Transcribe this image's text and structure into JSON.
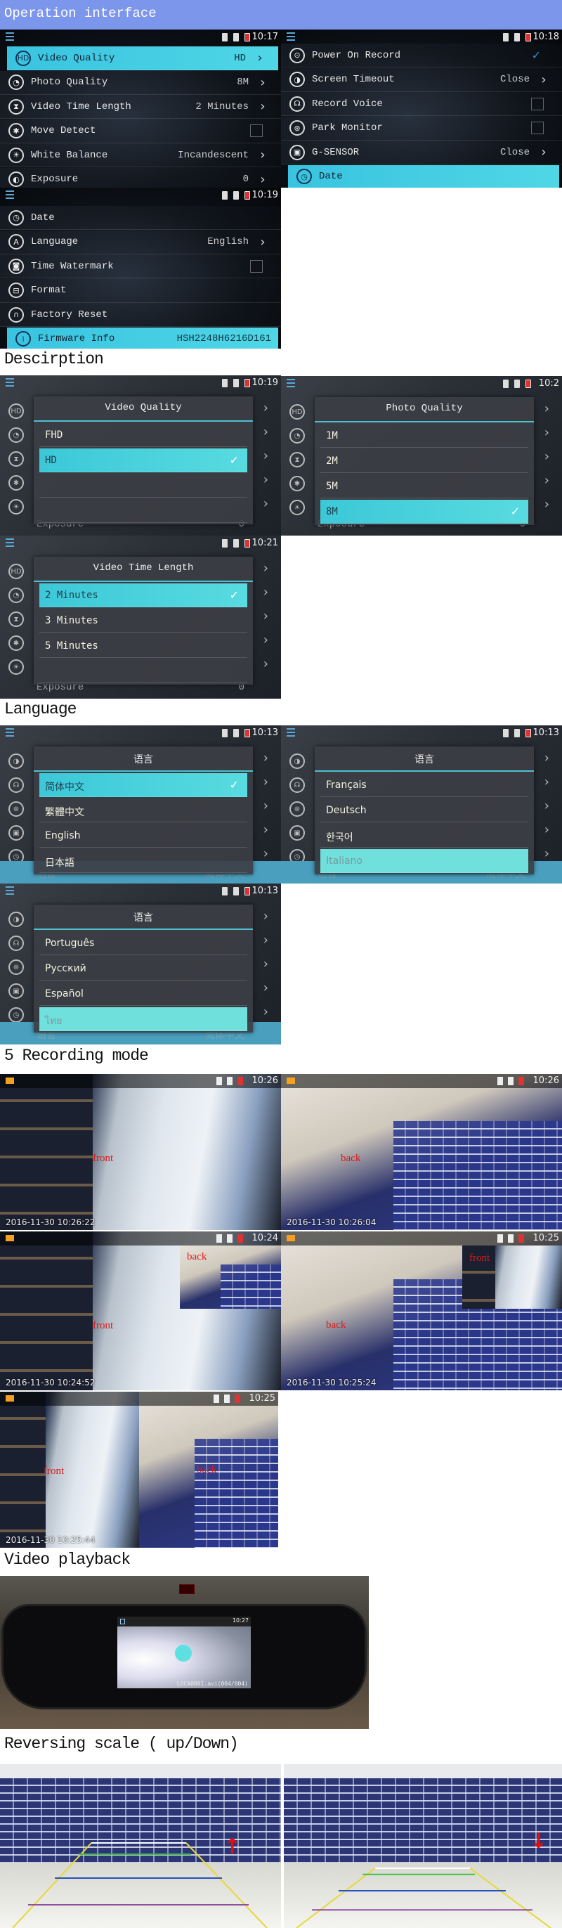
{
  "sections": {
    "operation": "Operation interface",
    "description": "Descirption",
    "language": "Language",
    "recording": "5 Recording mode",
    "playback": "Video playback",
    "reversing": "Reversing scale ( up/Down)"
  },
  "colors": {
    "header": "#7b96ea",
    "highlight": "#3fc8dc",
    "label_red": "#e01818"
  },
  "menus": [
    {
      "time": "10:17",
      "rows": [
        {
          "icon": "hd-icon",
          "label": "Video Quality",
          "value": "HD",
          "control": "chevron",
          "selected": true
        },
        {
          "icon": "photo-icon",
          "label": "Photo Quality",
          "value": "8M",
          "control": "chevron"
        },
        {
          "icon": "hourglass-icon",
          "label": "Video Time Length",
          "value": "2 Minutes",
          "control": "chevron"
        },
        {
          "icon": "walking-icon",
          "label": "Move Detect",
          "value": "",
          "control": "checkbox",
          "checked": false
        },
        {
          "icon": "sun-icon",
          "label": "White Balance",
          "value": "Incandescent",
          "control": "chevron"
        },
        {
          "icon": "exposure-icon",
          "label": "Exposure",
          "value": "0",
          "control": "chevron"
        }
      ]
    },
    {
      "time": "10:18",
      "rows": [
        {
          "icon": "power-icon",
          "label": "Power On Record",
          "value": "",
          "control": "check",
          "checked": true
        },
        {
          "icon": "toggle-icon",
          "label": "Screen Timeout",
          "value": "Close",
          "control": "chevron"
        },
        {
          "icon": "microphone-icon",
          "label": "Record Voice",
          "value": "",
          "control": "checkbox",
          "checked": false
        },
        {
          "icon": "car-icon",
          "label": "Park Monitor",
          "value": "",
          "control": "checkbox",
          "checked": false
        },
        {
          "icon": "lock-icon",
          "label": "G-SENSOR",
          "value": "Close",
          "control": "chevron"
        },
        {
          "icon": "clock-icon",
          "label": "Date",
          "value": "",
          "control": "none",
          "selected": true
        }
      ]
    },
    {
      "time": "10:19",
      "rows": [
        {
          "icon": "clock-icon",
          "label": "Date",
          "value": "",
          "control": "none"
        },
        {
          "icon": "language-icon",
          "label": "Language",
          "value": "English",
          "control": "chevron"
        },
        {
          "icon": "watermark-icon",
          "label": "Time Watermark",
          "value": "",
          "control": "checkbox",
          "checked": false
        },
        {
          "icon": "format-icon",
          "label": "Format",
          "value": "",
          "control": "none"
        },
        {
          "icon": "reset-icon",
          "label": "Factory Reset",
          "value": "",
          "control": "none"
        },
        {
          "icon": "info-icon",
          "label": "Firmware Info",
          "value": "HSH2248H6216D161",
          "control": "none",
          "selected": true
        }
      ]
    }
  ],
  "dialogs": [
    {
      "time": "10:19",
      "title": "Video Quality",
      "options": [
        "FHD",
        "HD"
      ],
      "selected": 1,
      "checkmark": true,
      "bg_label": "Exposure",
      "bg_value": "0"
    },
    {
      "time": "10:2",
      "title": "Photo Quality",
      "options": [
        "1M",
        "2M",
        "5M",
        "8M"
      ],
      "selected": 3,
      "checkmark": true,
      "bg_label": "Exposure",
      "bg_value": "0"
    },
    {
      "time": "10:21",
      "title": "Video Time Length",
      "options": [
        "2 Minutes",
        "3 Minutes",
        "5 Minutes"
      ],
      "selected": 0,
      "checkmark": true,
      "bg_label": "Exposure",
      "bg_value": "0"
    }
  ],
  "languages": [
    {
      "time": "10:13",
      "title": "语言",
      "options": [
        "简体中文",
        "繁體中文",
        "English",
        "日本語"
      ],
      "selected": 0,
      "checkmark": true,
      "bg_label": "语言",
      "bg_value": "简体中文"
    },
    {
      "time": "10:13",
      "title": "语言",
      "options": [
        "Français",
        "Deutsch",
        "한국어",
        "Italiano"
      ],
      "selected": 3,
      "checkmark": false,
      "bg_label": "语言",
      "bg_value": "简体中文"
    },
    {
      "time": "10:13",
      "title": "语言",
      "options": [
        "Português",
        "Русский",
        "Español",
        "ไทย"
      ],
      "selected": 3,
      "checkmark": false,
      "bg_label": "语言",
      "bg_value": "简体中文"
    }
  ],
  "recordings": [
    {
      "time": "10:26",
      "timestamp": "2016-11-30  10:26:22",
      "mode": "front",
      "labels": [
        "front"
      ]
    },
    {
      "time": "10:26",
      "timestamp": "2016-11-30  10:26:04",
      "mode": "back",
      "labels": [
        "back"
      ]
    },
    {
      "time": "10:24",
      "timestamp": "2016-11-30  10:24:52",
      "mode": "front-pip-back",
      "labels": [
        "front",
        "back"
      ]
    },
    {
      "time": "10:25",
      "timestamp": "2016-11-30  10:25:24",
      "mode": "back-pip-front",
      "labels": [
        "back",
        "front"
      ]
    },
    {
      "time": "10:25",
      "timestamp": "2016-11-30  10:25:44",
      "mode": "split",
      "labels": [
        "front",
        "back"
      ]
    }
  ],
  "playback": {
    "time": "10:27",
    "file": "LOCA0001.avi(004/004)",
    "icon": "play-icon"
  },
  "reversing": [
    {
      "direction": "up",
      "icon": "arrow-up-icon"
    },
    {
      "direction": "down",
      "icon": "arrow-down-icon"
    }
  ]
}
